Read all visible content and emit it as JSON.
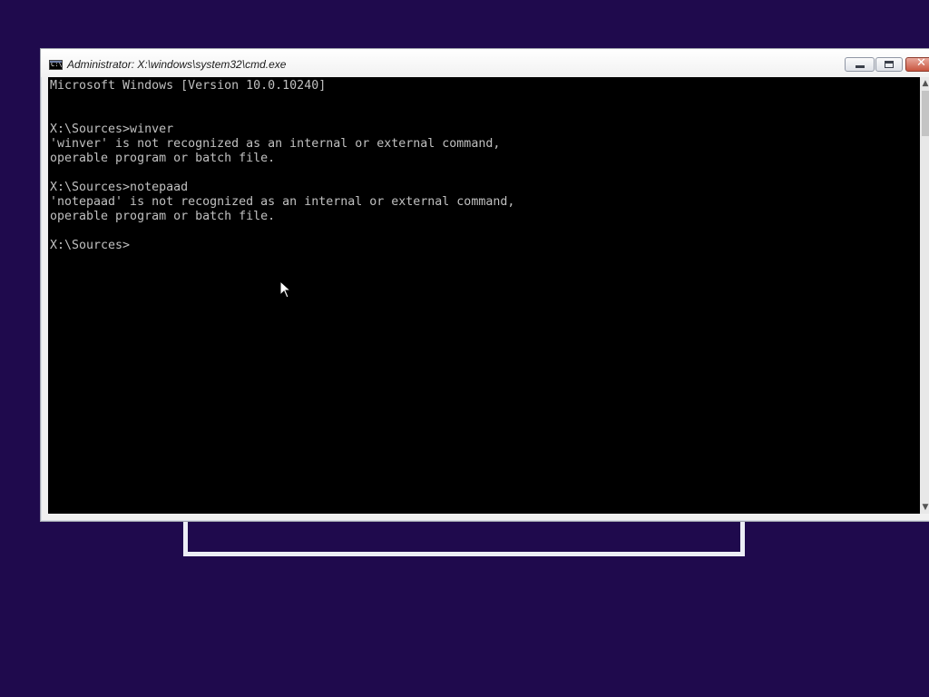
{
  "window": {
    "title": "Administrator: X:\\windows\\system32\\cmd.exe",
    "icon": "cmd-icon",
    "icon_label": "C:\\",
    "controls": [
      "minimize-icon",
      "maximize-icon",
      "close-icon"
    ],
    "close_glyph": "✕"
  },
  "console": {
    "lines": [
      "Microsoft Windows [Version 10.0.10240]",
      "",
      "",
      "X:\\Sources>winver",
      "'winver' is not recognized as an internal or external command,",
      "operable program or batch file.",
      "",
      "X:\\Sources>notepaad",
      "'notepaad' is not recognized as an internal or external command,",
      "operable program or batch file.",
      "",
      "X:\\Sources>"
    ]
  },
  "scrollbar": {
    "up_glyph": "▲",
    "down_glyph": "▼"
  },
  "colors": {
    "desktop_background": "#1f0a4d",
    "console_background": "#000000",
    "console_text": "#c0c0c0"
  }
}
